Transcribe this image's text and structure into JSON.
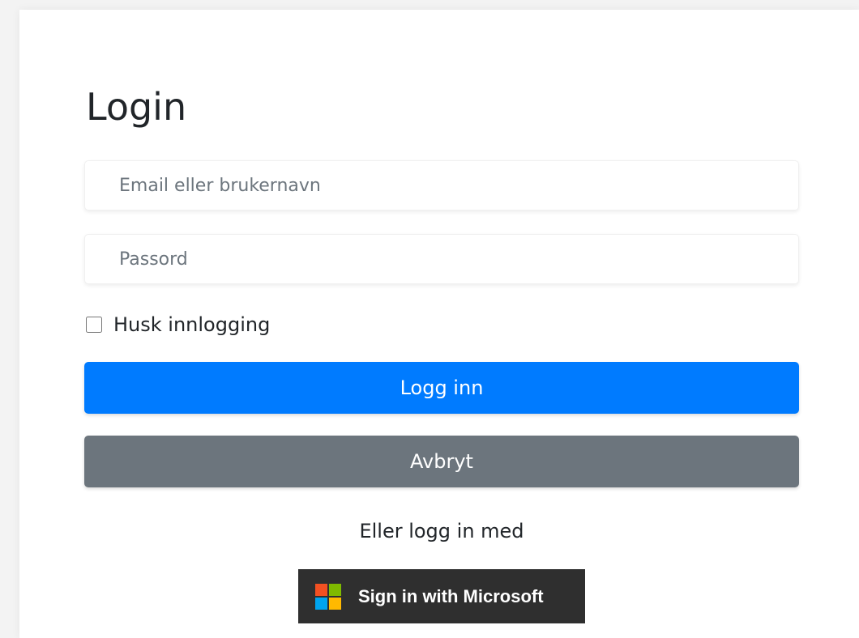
{
  "login": {
    "title": "Login",
    "email_placeholder": "Email eller brukernavn",
    "password_placeholder": "Passord",
    "remember_label": "Husk innlogging",
    "remember_checked": false,
    "login_button": "Logg inn",
    "cancel_button": "Avbryt",
    "alternative_text": "Eller logg in med",
    "microsoft_button": "Sign in with Microsoft"
  },
  "colors": {
    "primary": "#007bff",
    "secondary": "#6c757d",
    "microsoft_bg": "#2f2f2f",
    "ms_red": "#f25022",
    "ms_green": "#7fba00",
    "ms_blue": "#00a4ef",
    "ms_yellow": "#ffb900"
  },
  "icons": {
    "microsoft": "microsoft-logo-icon"
  }
}
